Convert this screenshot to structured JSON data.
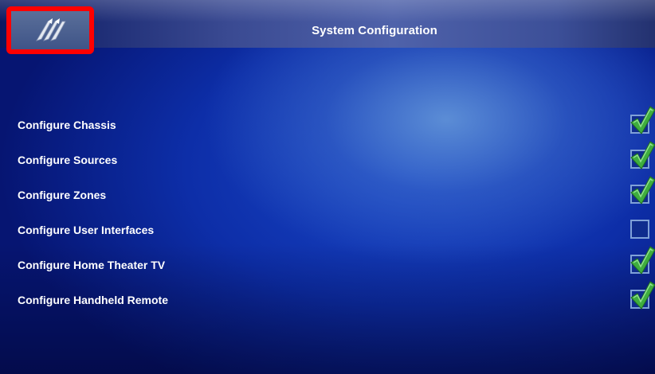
{
  "header": {
    "title": "System Configuration",
    "back_icon": "back-arrows-icon"
  },
  "colors": {
    "highlight": "#ff0000",
    "check": "#3fae3f",
    "text": "#ffffff"
  },
  "options": [
    {
      "label": "Configure Chassis",
      "checked": true
    },
    {
      "label": "Configure Sources",
      "checked": true
    },
    {
      "label": "Configure Zones",
      "checked": true
    },
    {
      "label": "Configure User Interfaces",
      "checked": false
    },
    {
      "label": "Configure Home Theater TV",
      "checked": true
    },
    {
      "label": "Configure Handheld Remote",
      "checked": true
    }
  ]
}
